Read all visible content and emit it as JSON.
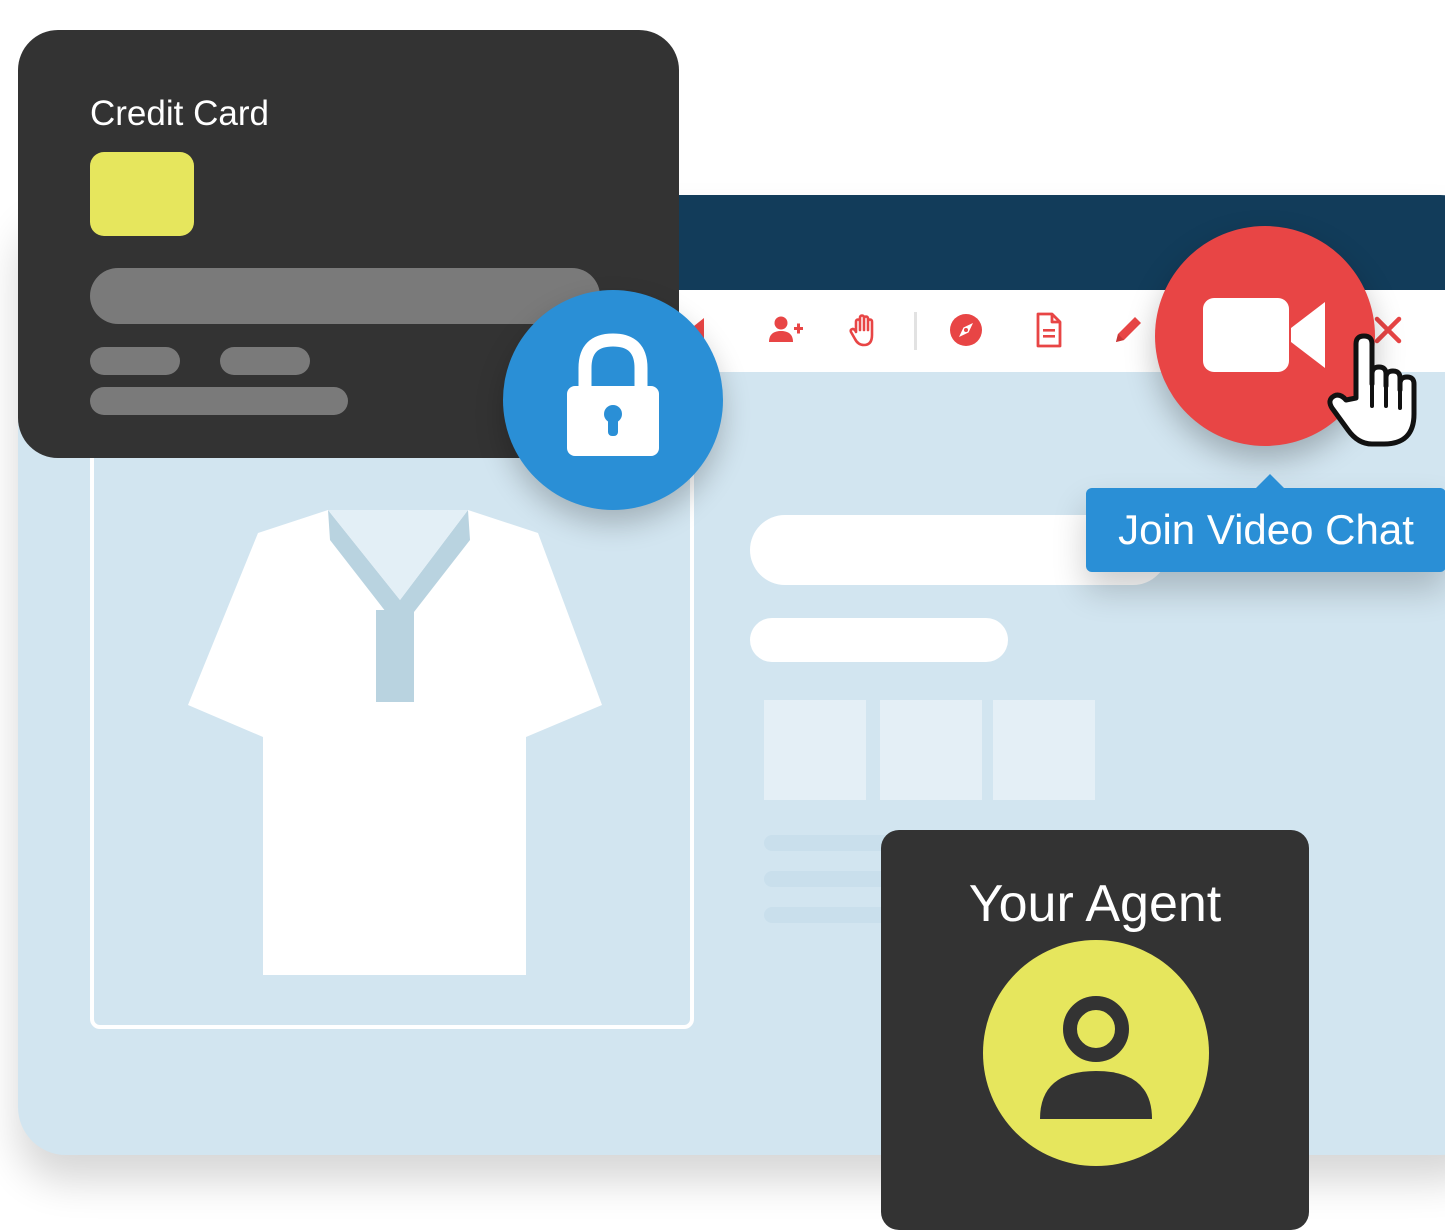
{
  "credit_card": {
    "title": "Credit Card"
  },
  "toolbar": {
    "icons": [
      "audio-icon",
      "add-user-icon",
      "hand-icon",
      "compass-icon",
      "document-icon",
      "pencil-icon",
      "close-icon"
    ]
  },
  "video_chat": {
    "tooltip_label": "Join Video Chat"
  },
  "agent_card": {
    "title": "Your Agent"
  },
  "colors": {
    "browser_titlebar": "#123c5a",
    "browser_body": "#d2e5f0",
    "card_dark": "#333333",
    "chip_yellow": "#e6e65d",
    "lock_blue": "#2a8fd6",
    "video_red": "#e84545",
    "toolbar_icon_red": "#e84545"
  }
}
